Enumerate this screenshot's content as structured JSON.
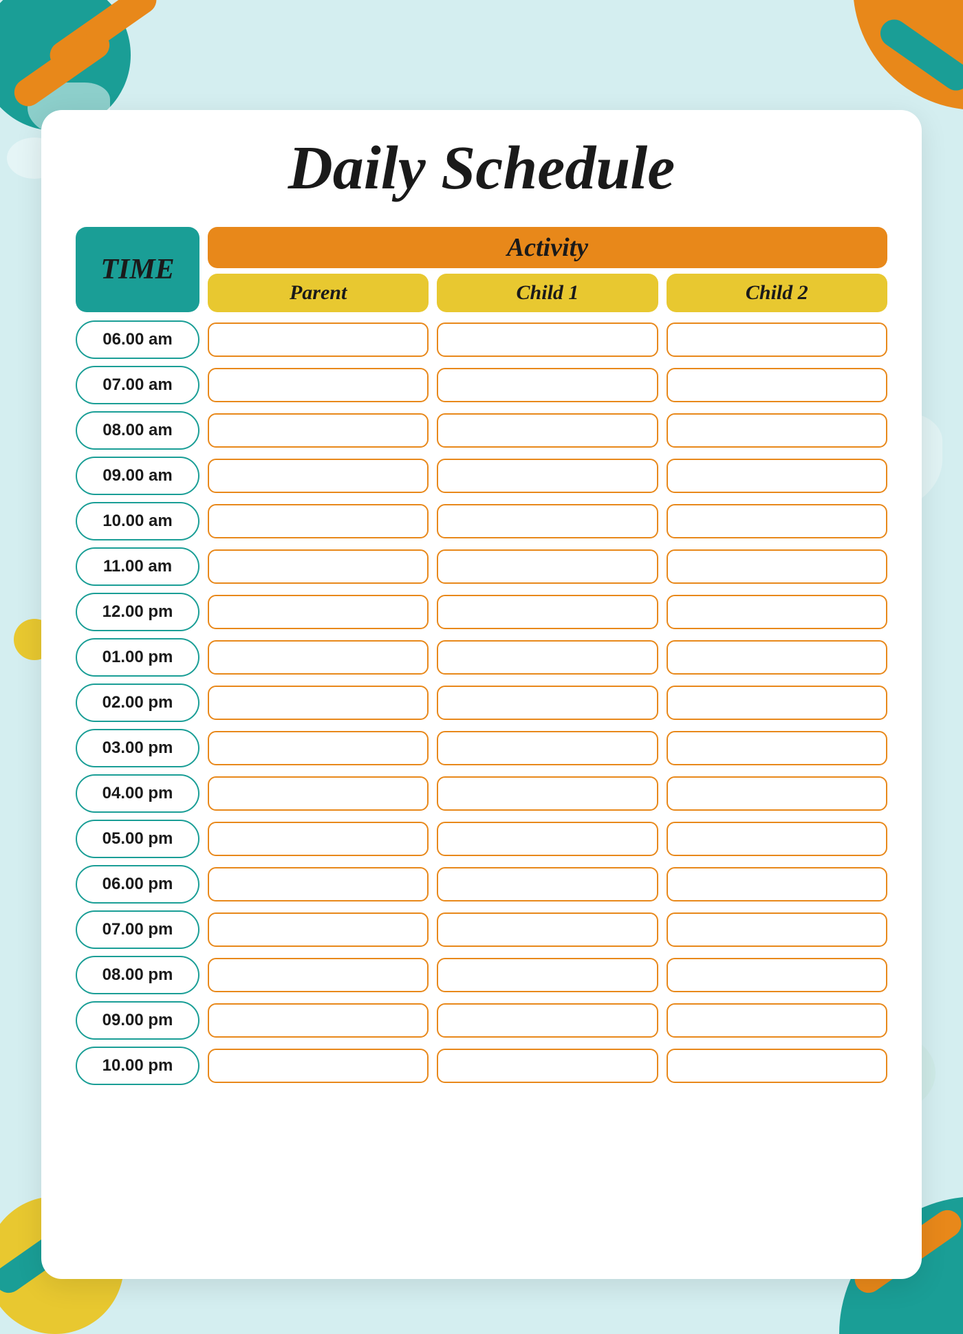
{
  "title": "Daily Schedule",
  "time_header": "TIME",
  "activity_banner": "Activity",
  "columns": [
    "Parent",
    "Child 1",
    "Child 2"
  ],
  "times": [
    "06.00 am",
    "07.00 am",
    "08.00 am",
    "09.00 am",
    "10.00 am",
    "11.00 am",
    "12.00 pm",
    "01.00 pm",
    "02.00 pm",
    "03.00 pm",
    "04.00 pm",
    "05.00 pm",
    "06.00 pm",
    "07.00 pm",
    "08.00 pm",
    "09.00 pm",
    "10.00 pm"
  ],
  "colors": {
    "teal": "#1a9e96",
    "orange": "#e8881a",
    "yellow": "#e8c830",
    "bg": "#d4eef0",
    "white": "#ffffff"
  }
}
